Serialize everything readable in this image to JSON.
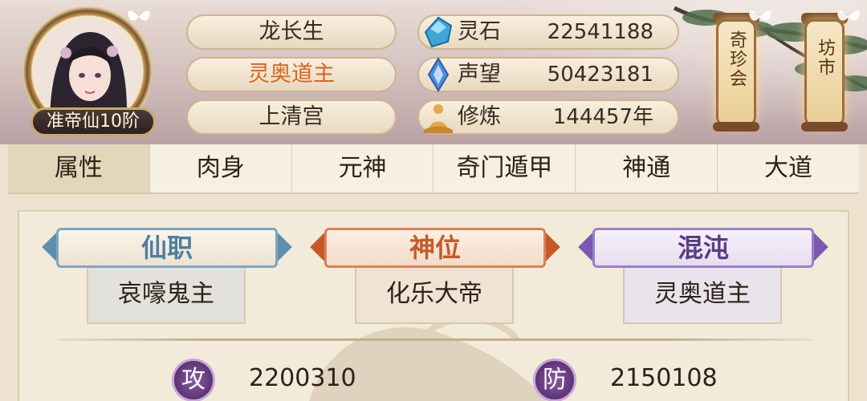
{
  "player": {
    "name": "龙长生",
    "title": "灵奥道主",
    "sect": "上清宫",
    "rank": "准帝仙10阶"
  },
  "resources": [
    {
      "icon": "spirit-stone-icon",
      "label": "灵石",
      "value": "22541188"
    },
    {
      "icon": "prestige-icon",
      "label": "声望",
      "value": "50423181"
    },
    {
      "icon": "cultivation-icon",
      "label": "修炼",
      "value": "144457年"
    }
  ],
  "shops": [
    {
      "label": "奇珍会"
    },
    {
      "label": "坊市"
    }
  ],
  "tabs": [
    {
      "label": "属性",
      "active": true
    },
    {
      "label": "肉身",
      "active": false
    },
    {
      "label": "元神",
      "active": false
    },
    {
      "label": "奇门遁甲",
      "active": false
    },
    {
      "label": "神通",
      "active": false
    },
    {
      "label": "大道",
      "active": false
    }
  ],
  "positions": [
    {
      "header": "仙职",
      "value": "哀嚎鬼主",
      "color": "#4f7fa0"
    },
    {
      "header": "神位",
      "value": "化乐大帝",
      "color": "#c8582a"
    },
    {
      "header": "混沌",
      "value": "灵奥道主",
      "color": "#5a3c86"
    }
  ],
  "stats": [
    {
      "icon_char": "攻",
      "value": "2200310"
    },
    {
      "icon_char": "防",
      "value": "2150108"
    }
  ],
  "colors": {
    "title_orange": "#d9641f",
    "stat_icon_purple": "#6a3c86"
  }
}
